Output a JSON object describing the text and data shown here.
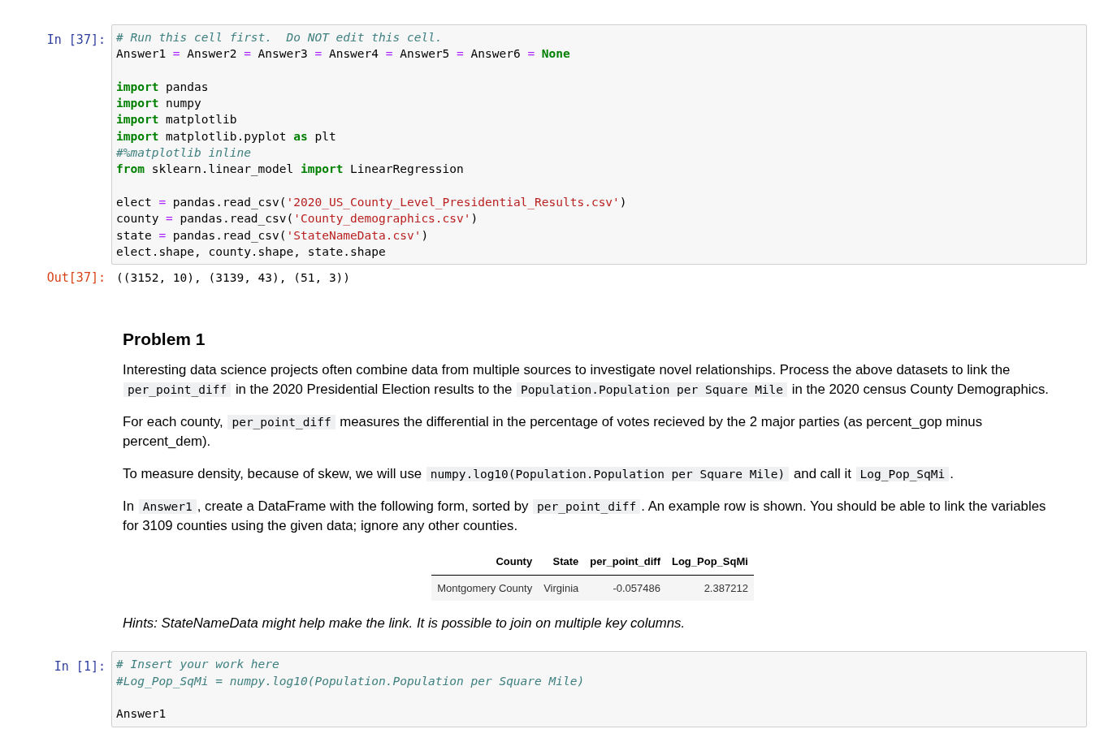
{
  "cells": [
    {
      "kind": "code",
      "prompt": "In [37]:",
      "blocks": [
        [
          [
            {
              "kind": "comment",
              "text": "# Run this cell first.  Do NOT edit this cell."
            }
          ],
          [
            {
              "kind": "plain",
              "text": "Answer1 "
            },
            {
              "kind": "op",
              "text": "="
            },
            {
              "kind": "plain",
              "text": " Answer2 "
            },
            {
              "kind": "op",
              "text": "="
            },
            {
              "kind": "plain",
              "text": " Answer3 "
            },
            {
              "kind": "op",
              "text": "="
            },
            {
              "kind": "plain",
              "text": " Answer4 "
            },
            {
              "kind": "op",
              "text": "="
            },
            {
              "kind": "plain",
              "text": " Answer5 "
            },
            {
              "kind": "op",
              "text": "="
            },
            {
              "kind": "plain",
              "text": " Answer6 "
            },
            {
              "kind": "op",
              "text": "="
            },
            {
              "kind": "keyword",
              "text": " None"
            }
          ]
        ],
        [
          [
            {
              "kind": "keyword",
              "text": "import"
            },
            {
              "kind": "plain",
              "text": " pandas"
            }
          ],
          [
            {
              "kind": "keyword",
              "text": "import"
            },
            {
              "kind": "plain",
              "text": " numpy"
            }
          ],
          [
            {
              "kind": "keyword",
              "text": "import"
            },
            {
              "kind": "plain",
              "text": " matplotlib"
            }
          ],
          [
            {
              "kind": "keyword",
              "text": "import"
            },
            {
              "kind": "plain",
              "text": " matplotlib.pyplot "
            },
            {
              "kind": "keyword",
              "text": "as"
            },
            {
              "kind": "plain",
              "text": " plt"
            }
          ],
          [
            {
              "kind": "comment",
              "text": "#%matplotlib inline"
            }
          ],
          [
            {
              "kind": "keyword",
              "text": "from"
            },
            {
              "kind": "plain",
              "text": " sklearn.linear_model "
            },
            {
              "kind": "keyword",
              "text": "import"
            },
            {
              "kind": "plain",
              "text": " LinearRegression"
            }
          ]
        ],
        [
          [
            {
              "kind": "plain",
              "text": "elect "
            },
            {
              "kind": "op",
              "text": "="
            },
            {
              "kind": "plain",
              "text": " pandas.read_csv("
            },
            {
              "kind": "string",
              "text": "'2020_US_County_Level_Presidential_Results.csv'"
            },
            {
              "kind": "plain",
              "text": ")"
            }
          ],
          [
            {
              "kind": "plain",
              "text": "county "
            },
            {
              "kind": "op",
              "text": "="
            },
            {
              "kind": "plain",
              "text": " pandas.read_csv("
            },
            {
              "kind": "string",
              "text": "'County_demographics.csv'"
            },
            {
              "kind": "plain",
              "text": ")"
            }
          ],
          [
            {
              "kind": "plain",
              "text": "state "
            },
            {
              "kind": "op",
              "text": "="
            },
            {
              "kind": "plain",
              "text": " pandas.read_csv("
            },
            {
              "kind": "string",
              "text": "'StateNameData.csv'"
            },
            {
              "kind": "plain",
              "text": ")"
            }
          ],
          [
            {
              "kind": "plain",
              "text": "elect.shape, county.shape, state.shape"
            }
          ]
        ]
      ],
      "output": {
        "prompt": "Out[37]:",
        "text": "((3152, 10), (3139, 43), (51, 3))"
      }
    },
    {
      "kind": "markdown",
      "heading": "Problem 1",
      "paragraphs": [
        {
          "kind": "text",
          "segments": [
            {
              "kind": "text",
              "text": "Interesting data science projects often combine data from multiple sources to investigate novel relationships. Process the above datasets to link the "
            },
            {
              "kind": "code",
              "text": "per_point_diff"
            },
            {
              "kind": "text",
              "text": " in the 2020 Presidential Election results to the "
            },
            {
              "kind": "code",
              "text": "Population.Population per Square Mile"
            },
            {
              "kind": "text",
              "text": " in the 2020 census County Demographics."
            }
          ]
        },
        {
          "kind": "text",
          "segments": [
            {
              "kind": "text",
              "text": "For each county, "
            },
            {
              "kind": "code",
              "text": "per_point_diff"
            },
            {
              "kind": "text",
              "text": " measures the differential in the percentage of votes recieved by the 2 major parties (as percent_gop minus percent_dem)."
            }
          ]
        },
        {
          "kind": "text",
          "segments": [
            {
              "kind": "text",
              "text": "To measure density, because of skew, we will use "
            },
            {
              "kind": "code",
              "text": "numpy.log10(Population.Population per Square Mile)"
            },
            {
              "kind": "text",
              "text": " and call it "
            },
            {
              "kind": "code",
              "text": "Log_Pop_SqMi"
            },
            {
              "kind": "text",
              "text": "."
            }
          ]
        },
        {
          "kind": "text",
          "segments": [
            {
              "kind": "text",
              "text": "In "
            },
            {
              "kind": "code",
              "text": "Answer1"
            },
            {
              "kind": "text",
              "text": ", create a DataFrame with the following form, sorted by "
            },
            {
              "kind": "code",
              "text": "per_point_diff"
            },
            {
              "kind": "text",
              "text": ". An example row is shown. You should be able to link the variables for 3109 counties using the given data; ignore any other counties."
            }
          ]
        },
        {
          "kind": "table",
          "columns": [
            "County",
            "State",
            "per_point_diff",
            "Log_Pop_SqMi"
          ],
          "rows": [
            [
              "Montgomery County",
              "Virginia",
              "-0.057486",
              "2.387212"
            ]
          ]
        },
        {
          "kind": "hint",
          "text": "Hints: StateNameData might help make the link. It is possible to join on multiple key columns."
        }
      ]
    },
    {
      "kind": "code",
      "prompt": "In [1]:",
      "blocks": [
        [
          [
            {
              "kind": "comment",
              "text": "# Insert your work here"
            }
          ],
          [
            {
              "kind": "comment",
              "text": "#Log_Pop_SqMi = numpy.log10(Population.Population per Square Mile)"
            }
          ]
        ],
        [
          [
            {
              "kind": "plain",
              "text": "Answer1"
            }
          ]
        ]
      ]
    }
  ]
}
